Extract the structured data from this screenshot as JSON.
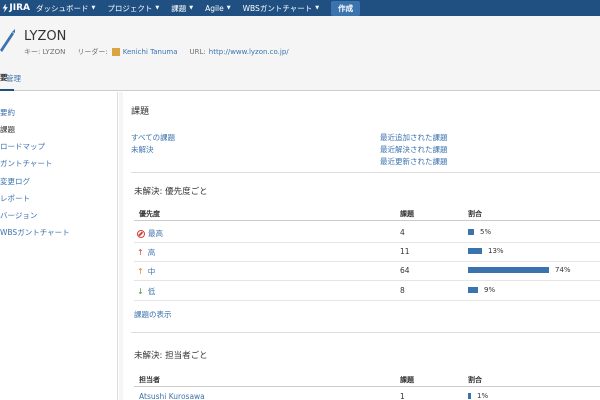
{
  "nav": {
    "logo": "JIRA",
    "items": [
      "ダッシュボード",
      "プロジェクト",
      "課題",
      "Agile",
      "WBSガントチャート"
    ],
    "create": "作成"
  },
  "project": {
    "name": "LYZON",
    "key_label": "キー: LYZON",
    "lead_label": "リーダー:",
    "lead_name": "Kenichi Tanuma",
    "url_label": "URL:",
    "url": "http://www.lyzon.co.jp/"
  },
  "tabs": [
    "要",
    "管理"
  ],
  "sidebar": {
    "items": [
      "要約",
      "課題",
      "ロードマップ",
      "ガントチャート",
      "変更ログ",
      "レポート",
      "バージョン",
      "WBSガントチャート"
    ]
  },
  "issues": {
    "title": "課題",
    "left_links": [
      "すべての課題",
      "未解決"
    ],
    "right_links": [
      "最近追加された課題",
      "最近解決された課題",
      "最近更新された課題"
    ]
  },
  "by_priority": {
    "title": "未解決: 優先度ごと",
    "headers": [
      "優先度",
      "課題",
      "割合"
    ],
    "rows": [
      {
        "label": "最高",
        "count": "4",
        "pct_label": "5%",
        "pct": 5
      },
      {
        "label": "高",
        "count": "11",
        "pct_label": "13%",
        "pct": 13
      },
      {
        "label": "中",
        "count": "64",
        "pct_label": "74%",
        "pct": 74
      },
      {
        "label": "低",
        "count": "8",
        "pct_label": "9%",
        "pct": 9
      }
    ],
    "footer_link": "課題の表示"
  },
  "by_assignee": {
    "title": "未解決: 担当者ごと",
    "headers": [
      "担当者",
      "課題",
      "割合"
    ],
    "rows": [
      {
        "label": "Atsushi Kurosawa",
        "count": "1",
        "pct_label": "1%",
        "pct": 1
      }
    ]
  },
  "colors": {
    "nav_bg": "#205081",
    "accent": "#3b73af",
    "blocker": "#d04437",
    "low": "#3d9b35"
  }
}
